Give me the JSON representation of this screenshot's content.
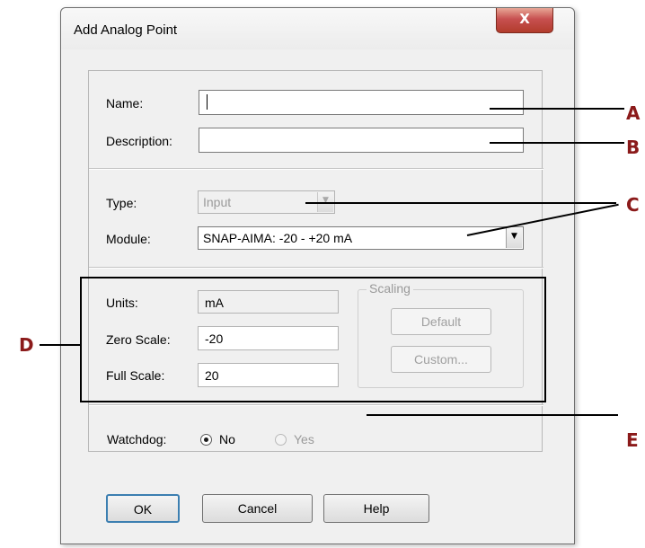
{
  "dialog": {
    "title": "Add Analog Point",
    "close_symbol": "X"
  },
  "fields": {
    "name_label": "Name:",
    "name_value": "",
    "description_label": "Description:",
    "description_value": "",
    "type_label": "Type:",
    "type_value": "Input",
    "module_label": "Module:",
    "module_value": "SNAP-AIMA: -20 - +20 mA",
    "units_label": "Units:",
    "units_value": "mA",
    "zero_scale_label": "Zero Scale:",
    "zero_scale_value": "-20",
    "full_scale_label": "Full Scale:",
    "full_scale_value": "20"
  },
  "scaling": {
    "legend": "Scaling",
    "default_label": "Default",
    "custom_label": "Custom..."
  },
  "watchdog": {
    "label": "Watchdog:",
    "no_label": "No",
    "yes_label": "Yes",
    "selected": "No"
  },
  "buttons": {
    "ok": "OK",
    "cancel": "Cancel",
    "help": "Help"
  },
  "callouts": {
    "a": "A",
    "b": "B",
    "c": "C",
    "d": "D",
    "e": "E"
  },
  "colors": {
    "callout": "#8b1a1a",
    "close_button": "#c75050",
    "dialog_background": "#f0f0f0"
  }
}
